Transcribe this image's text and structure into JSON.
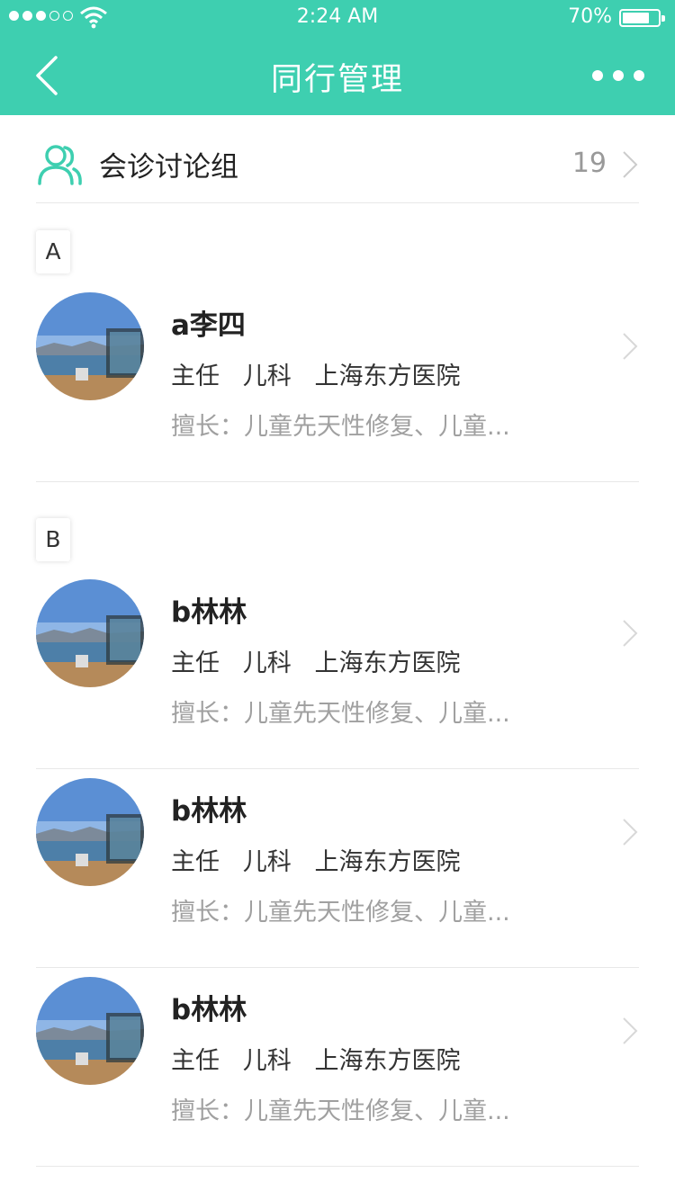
{
  "status": {
    "time": "2:24 AM",
    "battery": "70%"
  },
  "nav": {
    "title": "同行管理",
    "back_icon": "back-chevron-icon",
    "more_icon": "more-dots-icon"
  },
  "group": {
    "label": "会诊讨论组",
    "count": "19",
    "icon": "people-icon"
  },
  "sections": [
    {
      "letter": "A",
      "contacts": [
        {
          "name": "a李四",
          "info": "主任   儿科   上海东方医院",
          "skill": "擅长：儿童先天性修复、儿童..."
        }
      ]
    },
    {
      "letter": "B",
      "contacts": [
        {
          "name": "b林林",
          "info": "主任   儿科   上海东方医院",
          "skill": "擅长：儿童先天性修复、儿童..."
        },
        {
          "name": "b林林",
          "info": "主任   儿科   上海东方医院",
          "skill": "擅长：儿童先天性修复、儿童..."
        },
        {
          "name": "b林林",
          "info": "主任   儿科   上海东方医院",
          "skill": "擅长：儿童先天性修复、儿童..."
        }
      ]
    }
  ],
  "colors": {
    "accent": "#3ecfb0",
    "muted": "#a0a0a0"
  }
}
